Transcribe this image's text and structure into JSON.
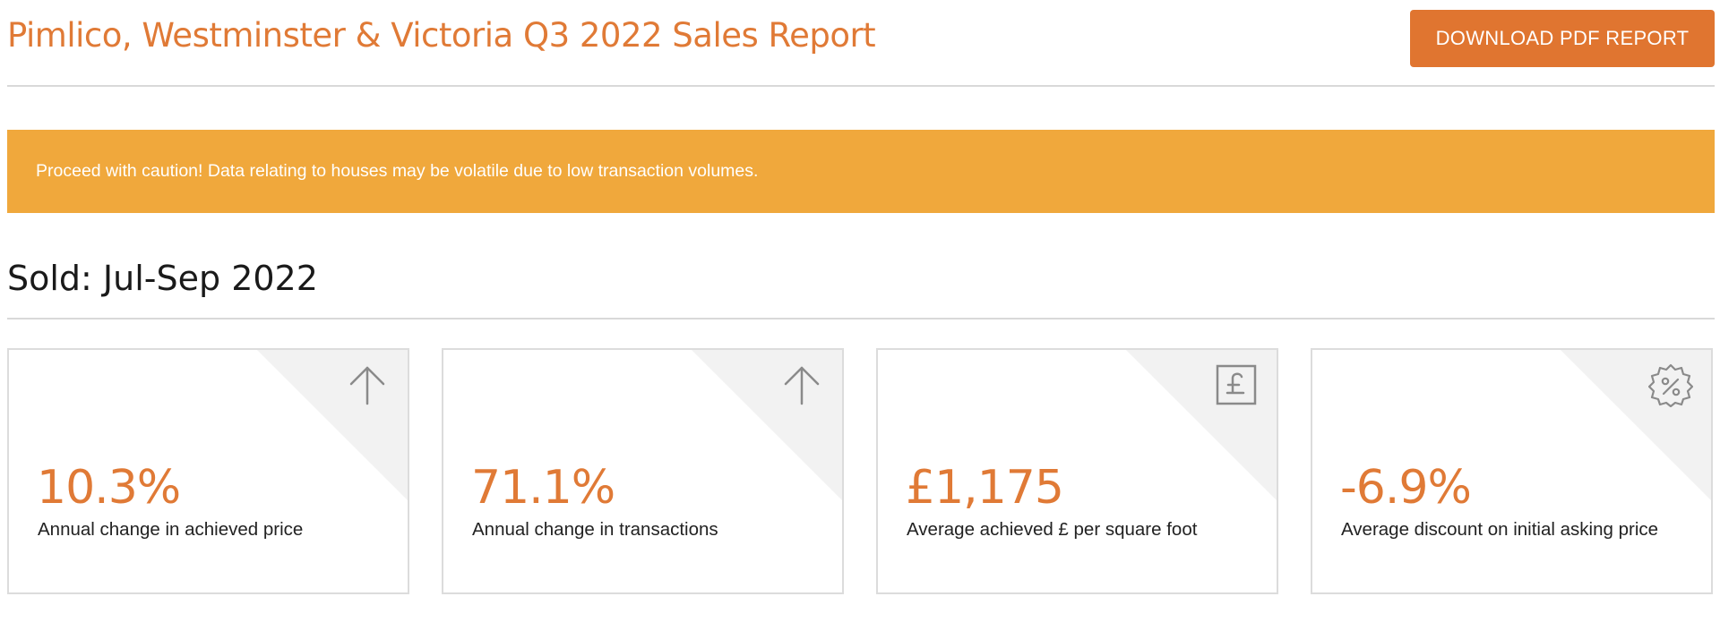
{
  "header": {
    "title": "Pimlico, Westminster & Victoria Q3 2022 Sales Report",
    "download_label": "DOWNLOAD PDF REPORT"
  },
  "alert": {
    "text": "Proceed with caution! Data relating to houses may be volatile due to low transaction volumes."
  },
  "section": {
    "title": "Sold: Jul-Sep 2022"
  },
  "stats": [
    {
      "value": "10.3%",
      "label": "Annual change in achieved price",
      "icon": "arrow-up-icon"
    },
    {
      "value": "71.1%",
      "label": "Annual change in transactions",
      "icon": "arrow-up-icon"
    },
    {
      "value": "£1,175",
      "label": "Average achieved £ per square foot",
      "icon": "pound-icon"
    },
    {
      "value": "-6.9%",
      "label": "Average discount on initial asking price",
      "icon": "discount-badge-icon"
    }
  ],
  "colors": {
    "accent": "#e07a36",
    "button": "#e07530",
    "alert": "#f0a83c",
    "icon": "#8a8a8a"
  }
}
